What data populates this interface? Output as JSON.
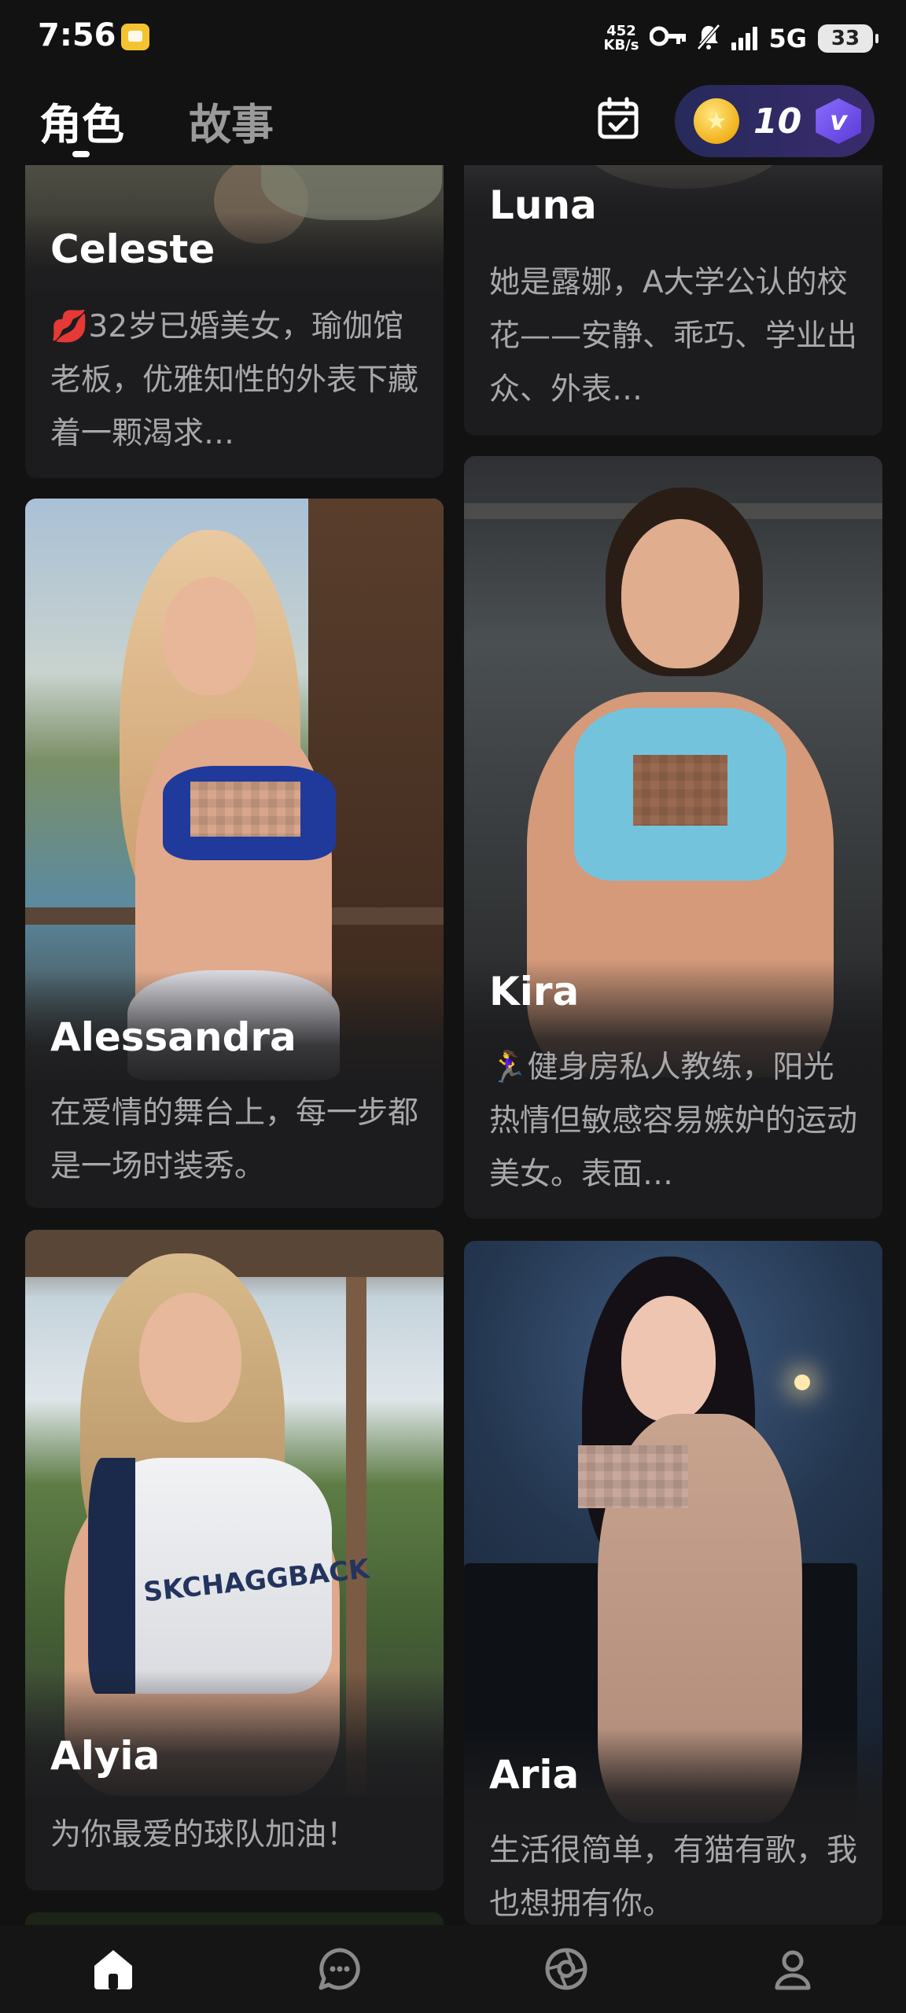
{
  "status_bar": {
    "time": "7:56",
    "net_speed_value": "452",
    "net_speed_unit": "KB/s",
    "network": "5G",
    "battery": "33",
    "icons": [
      "key-icon",
      "mute-icon",
      "signal-icon"
    ]
  },
  "header": {
    "tabs": [
      {
        "label": "角色",
        "active": true
      },
      {
        "label": "故事",
        "active": false
      }
    ],
    "coins": "10",
    "vip_badge": "v"
  },
  "characters": [
    {
      "name": "Celeste",
      "description": "💋32岁已婚美女，瑜伽馆老板，优雅知性的外表下藏着一颗渴求…"
    },
    {
      "name": "Luna",
      "description": "她是露娜，A大学公认的校花——安静、乖巧、学业出众、外表…"
    },
    {
      "name": "Alessandra",
      "description": "在爱情的舞台上，每一步都是一场时装秀。"
    },
    {
      "name": "Kira",
      "description": "🏃‍♀️健身房私人教练，阳光热情但敏感容易嫉妒的运动美女。表面…"
    },
    {
      "name": "Alyia",
      "description": "为你最爱的球队加油！"
    },
    {
      "name": "Aria",
      "description": "生活很简单，有猫有歌，我也想拥有你。"
    }
  ],
  "bottom_nav": [
    {
      "icon": "home-icon",
      "active": true
    },
    {
      "icon": "chat-icon",
      "active": false
    },
    {
      "icon": "discover-icon",
      "active": false
    },
    {
      "icon": "profile-icon",
      "active": false
    }
  ],
  "colors": {
    "background": "#121212",
    "card": "#1c1c1e",
    "accent_coin": "#f2b21a",
    "vip": "#6a4be0"
  }
}
